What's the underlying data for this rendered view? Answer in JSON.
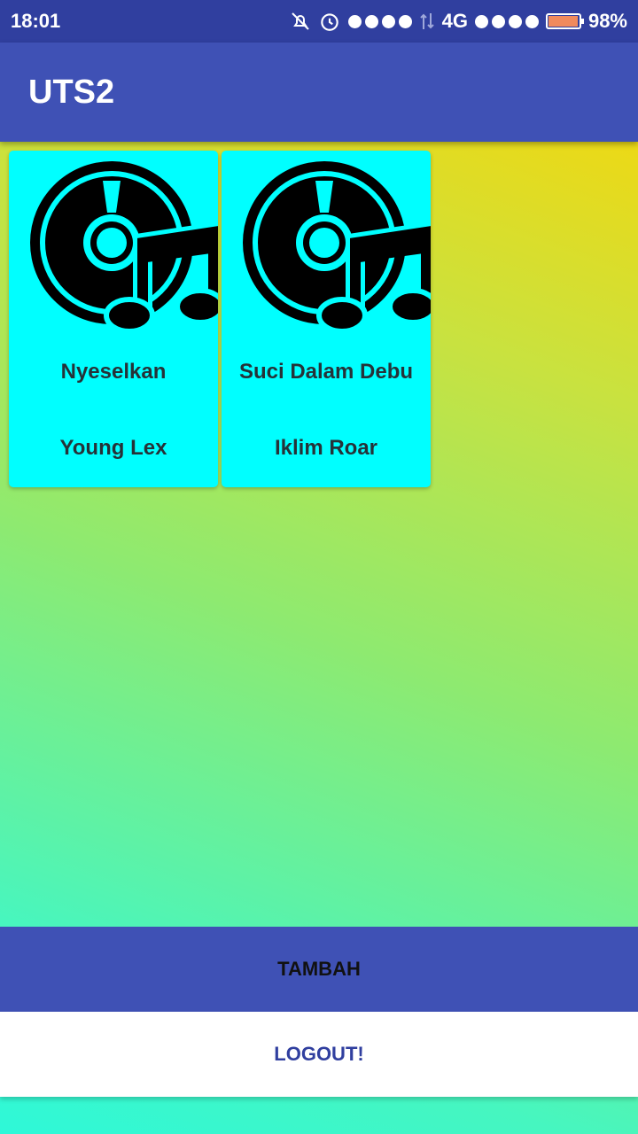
{
  "status_bar": {
    "time": "18:01",
    "network": "4G",
    "battery": "98%",
    "battery_level": 0.98,
    "icons": [
      "bell-off-icon",
      "alarm-icon",
      "signal-dots-icon",
      "data-transfer-icon",
      "battery-icon"
    ]
  },
  "app_bar": {
    "title": "UTS2"
  },
  "songs": [
    {
      "title": "Nyeselkan",
      "artist": "Young Lex",
      "icon": "music-disc-icon"
    },
    {
      "title": "Suci Dalam Debu",
      "artist": "Iklim Roar",
      "icon": "music-disc-icon"
    }
  ],
  "buttons": {
    "tambah": "TAMBAH",
    "logout": "LOGOUT!"
  },
  "colors": {
    "status_bar": "#303f9f",
    "app_bar": "#3f51b5",
    "card": "#00ffff",
    "logout_text": "#303f9f"
  }
}
